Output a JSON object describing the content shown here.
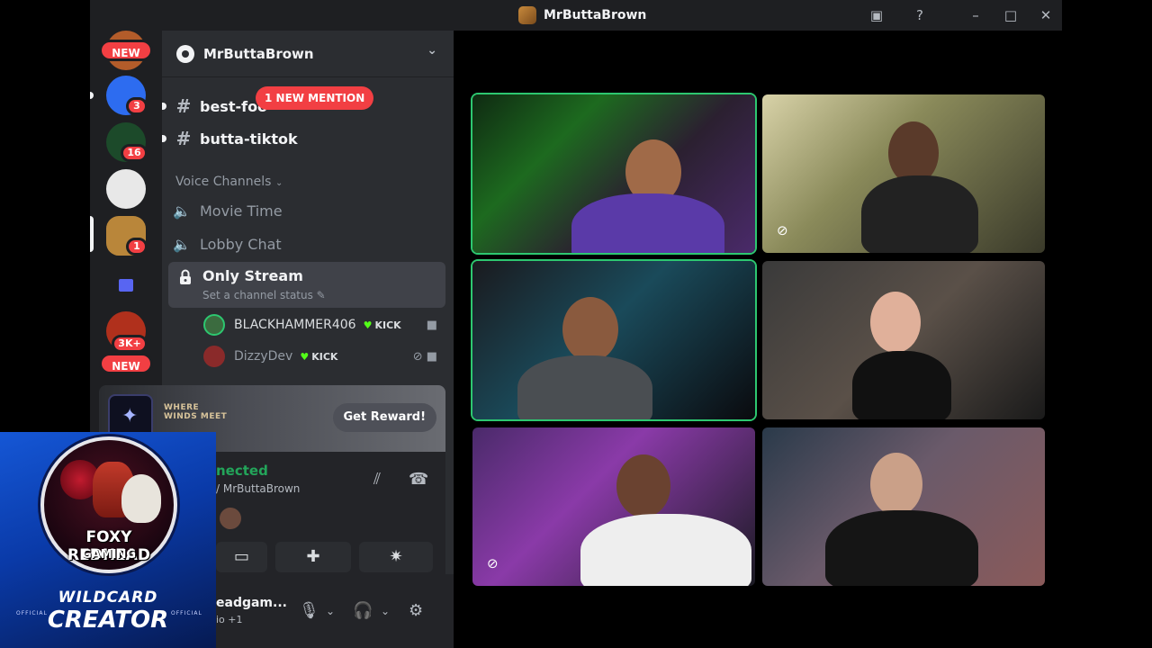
{
  "window": {
    "title": "MrButtaBrown"
  },
  "server_rail": {
    "new_top": "NEW",
    "badge_1": "3",
    "badge_2": "16",
    "badge_3": "1",
    "badge_4": "3K+",
    "new_bottom": "NEW"
  },
  "server": {
    "name": "MrButtaBrown"
  },
  "channels": {
    "text": [
      {
        "name": "best-foo"
      },
      {
        "name": "butta-tiktok"
      }
    ],
    "mention": "1 NEW MENTION",
    "voice_category": "Voice Channels",
    "voice": [
      {
        "name": "Movie Time"
      },
      {
        "name": "Lobby Chat"
      }
    ],
    "active": {
      "name": "Only Stream",
      "status": "Set a channel status"
    },
    "voice_users": [
      {
        "name": "BLACKHAMMER406",
        "tag": "KICK"
      },
      {
        "name": "DizzyDev",
        "tag": "KICK"
      }
    ]
  },
  "promo": {
    "logo_line1": "WHERE",
    "logo_line2": "WINDS MEET",
    "button": "Get Reward!"
  },
  "voice_panel": {
    "connected": "nected",
    "subtitle": "/ MrButtaBrown"
  },
  "user": {
    "name": "eadgam...",
    "sub": "io +1"
  },
  "overlay": {
    "line1": "FOXY REDHEAD",
    "line2": "GAMING",
    "wildcard": "WILDCARD",
    "creator": "CREATOR",
    "official_left": "OFFICIAL",
    "official_right": "OFFICIAL"
  },
  "colors": {
    "speaking_ring": "#2dc770",
    "danger": "#f23f43",
    "kick_green": "#53fc18"
  }
}
